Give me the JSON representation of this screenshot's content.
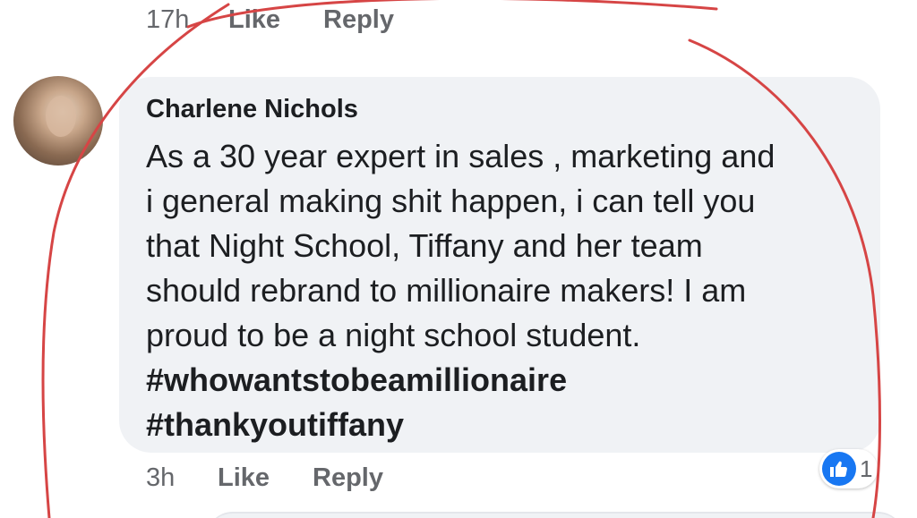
{
  "previous_comment": {
    "timestamp": "17h",
    "like_label": "Like",
    "reply_label": "Reply"
  },
  "comment": {
    "author": "Charlene Nichols",
    "lines": [
      "As a 30 year expert in sales , marketing and",
      "i general making shit happen,  i can tell you",
      "that Night School,  Tiffany and her team",
      "should rebrand to millionaire makers! I am",
      "proud to be a night school student."
    ],
    "hashtags": [
      "#whowantstobeamillionaire",
      "#thankyoutiffany"
    ],
    "timestamp": "3h",
    "like_label": "Like",
    "reply_label": "Reply",
    "reaction_count": "1",
    "reaction_icon": "thumbs-up-icon"
  },
  "colors": {
    "bubble": "#f0f2f5",
    "meta_text": "#65676b",
    "reaction_blue": "#1877f2",
    "annotation_red": "#d64545"
  }
}
